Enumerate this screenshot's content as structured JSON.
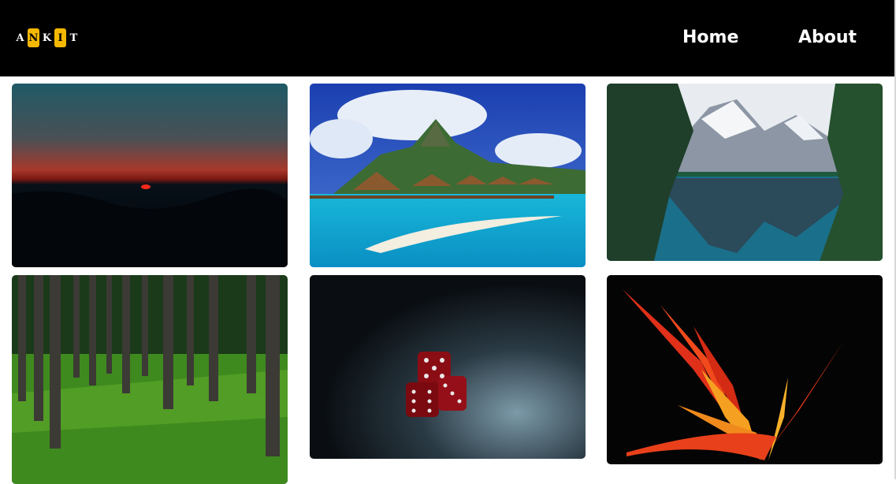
{
  "brand": {
    "letters": [
      "A",
      "N",
      "K",
      "I",
      "T"
    ],
    "highlighted": [
      1,
      3
    ]
  },
  "nav": {
    "home": "Home",
    "about": "About"
  },
  "colors": {
    "navbar_bg": "#000000",
    "logo_highlight": "#f5b800",
    "page_bg": "#ffffff"
  },
  "gallery": [
    {
      "name": "sunset-photo"
    },
    {
      "name": "tropical-island-photo"
    },
    {
      "name": "mountain-lake-photo"
    },
    {
      "name": "palm-forest-photo"
    },
    {
      "name": "dice-photo"
    },
    {
      "name": "bird-of-paradise-flower-photo"
    }
  ]
}
